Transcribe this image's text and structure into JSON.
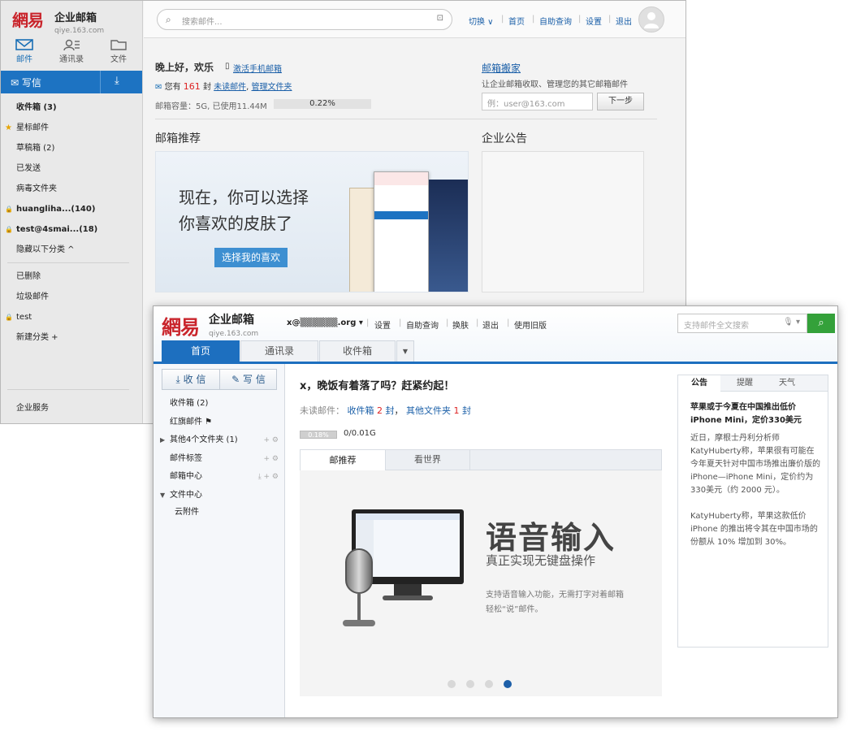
{
  "colors": {
    "brand_red": "#c9242b",
    "accent_blue": "#1d6fbf",
    "search_green": "#34a13a",
    "unread_red": "#dd2222"
  },
  "win_a": {
    "logo": {
      "mark": "網易",
      "name": "企业邮箱",
      "domain": "qiye.163.com"
    },
    "tabs": [
      {
        "label": "邮件",
        "icon": "mail-icon"
      },
      {
        "label": "通讯录",
        "icon": "contacts-icon"
      },
      {
        "label": "文件",
        "icon": "folder-icon"
      }
    ],
    "compose_label": "写信",
    "folders": [
      {
        "label": "收件箱 (3)",
        "bold": true
      },
      {
        "label": "星标邮件",
        "prefix": "★"
      },
      {
        "label": "草稿箱 (2)"
      },
      {
        "label": "已发送"
      },
      {
        "label": "病毒文件夹"
      },
      {
        "label": "huangliha...(140)",
        "bold": true,
        "prefix": "🔒"
      },
      {
        "label": "test@4smai...(18)",
        "bold": true,
        "prefix": "🔒"
      },
      {
        "label": "隐藏以下分类 ^"
      }
    ],
    "folders2": [
      {
        "label": "已删除"
      },
      {
        "label": "垃圾邮件"
      },
      {
        "label": "test",
        "prefix": "🔒"
      }
    ],
    "new_category": "新建分类 +",
    "enterprise_service": "企业服务",
    "search_placeholder": "搜索邮件...",
    "nav": [
      "切换 ∨",
      "首页",
      "自助查询",
      "设置",
      "退出"
    ],
    "greeting": "晚上好，欢乐",
    "activate_mobile": "激活手机邮箱",
    "unread_prefix": "您有",
    "unread_count": "161",
    "unread_unit": "封",
    "unread_link": "未读邮件",
    "manage_link": "管理文件夹",
    "capacity_text": "邮箱容量：5G, 已使用11.44M",
    "capacity_percent": "0.22%",
    "capacity_fraction": 0.0022,
    "migrate_title": "邮箱搬家",
    "migrate_desc": "让企业邮箱收取、管理您的其它邮箱邮件",
    "migrate_placeholder": "例：user@163.com",
    "migrate_next": "下一步",
    "recommend_title": "邮箱推荐",
    "notice_title": "企业公告",
    "banner_line1": "现在，你可以选择",
    "banner_line2": "你喜欢的皮肤了",
    "banner_button": "选择我的喜欢"
  },
  "win_b": {
    "logo": {
      "mark": "網易",
      "name": "企业邮箱",
      "domain": "qiye.163.com"
    },
    "account": "x@▒▒▒▒▒▒.org ▾",
    "nav": [
      "设置",
      "自助查询",
      "换肤",
      "退出",
      "使用旧版"
    ],
    "search_placeholder": "支持邮件全文搜索",
    "tabs": [
      "首页",
      "通讯录",
      "收件箱"
    ],
    "receive_label": "收 信",
    "write_label": "写 信",
    "folders": [
      {
        "label": "收件箱 (2)"
      },
      {
        "label": "红旗邮件 ⚑"
      },
      {
        "label": "其他4个文件夹 (1)",
        "arrow": "▶",
        "tools": "+ ⚙"
      },
      {
        "label": "邮件标签",
        "tools": "+ ⚙"
      },
      {
        "label": "邮箱中心",
        "tools": "⤓ + ⚙"
      },
      {
        "label": "文件中心",
        "arrow": "▼"
      },
      {
        "label": "云附件",
        "indent": true
      }
    ],
    "greeting": "x，晚饭有着落了吗？赶紧约起！",
    "unread_label": "未读邮件：",
    "unread_inbox": "收件箱",
    "unread_inbox_count": "2",
    "unread_other": "其他文件夹",
    "unread_other_count": "1",
    "unread_unit": "封",
    "quota_pct": "0.18%",
    "quota_val": "0/0.01G",
    "subtabs": [
      "邮推荐",
      "看世界"
    ],
    "promo_title": "语音输入",
    "promo_sub": "真正实现无键盘操作",
    "promo_desc": "支持语音输入功能，无需打字对着邮箱轻松“说”邮件。",
    "slide_count": 4,
    "slide_active": 4,
    "right_tabs": [
      "公告",
      "提醒",
      "天气"
    ],
    "news_title": "苹果或于今夏在中国推出低价iPhone Mini，定价330美元",
    "news_body1": "近日，摩根士丹利分析师KatyHuberty称，苹果很有可能在今年夏天针对中国市场推出廉价版的iPhone—iPhone Mini，定价约为330美元（约 2000 元）。",
    "news_body2": "KatyHuberty称，苹果这款低价iPhone 的推出将令其在中国市场的份额从 10% 增加到 30%。"
  }
}
